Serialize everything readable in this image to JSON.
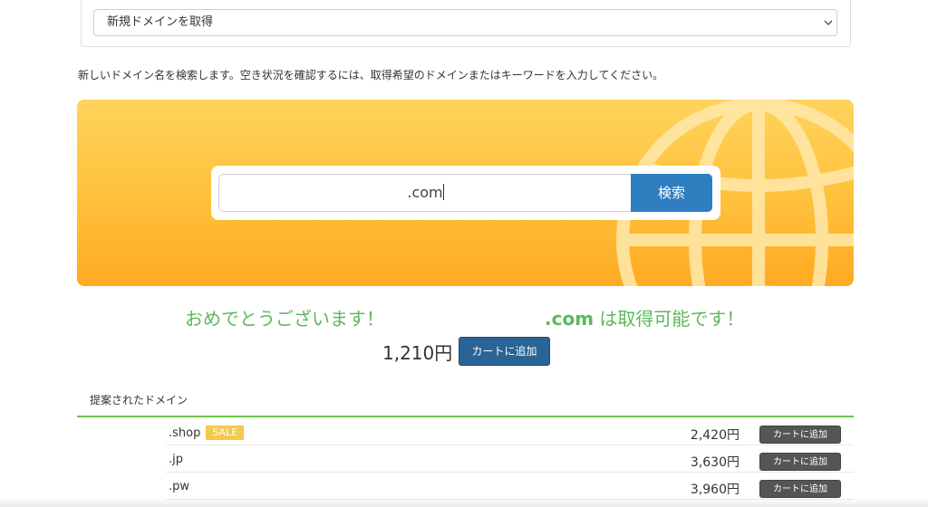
{
  "top_select": {
    "value": "新規ドメインを取得",
    "icon": "chevron-down-icon"
  },
  "intro_text": "新しいドメイン名を検索します。空き状況を確認するには、取得希望のドメインまたはキーワードを入力してください。",
  "search": {
    "value": ".com",
    "button_label": "検索"
  },
  "colors": {
    "banner": "#ffc23d",
    "search_button": "#2f7ebf",
    "success": "#5cb85c",
    "cart_main": "#2a6496",
    "cart_small": "#555555",
    "sale_badge": "#f5c94a",
    "rule": "#6cc24a"
  },
  "result": {
    "congrats": "おめでとうございます！",
    "domain": ".com",
    "available_text": "は取得可能です！",
    "price": "1,210円",
    "cart_label": "カートに追加"
  },
  "suggestions": {
    "title": "提案されたドメイン",
    "items": [
      {
        "domain": ".shop",
        "badge": "SALE",
        "price": "2,420円",
        "cart_label": "カートに追加"
      },
      {
        "domain": ".jp",
        "badge": "",
        "price": "3,630円",
        "cart_label": "カートに追加"
      },
      {
        "domain": ".pw",
        "badge": "",
        "price": "3,960円",
        "cart_label": "カートに追加"
      }
    ]
  }
}
